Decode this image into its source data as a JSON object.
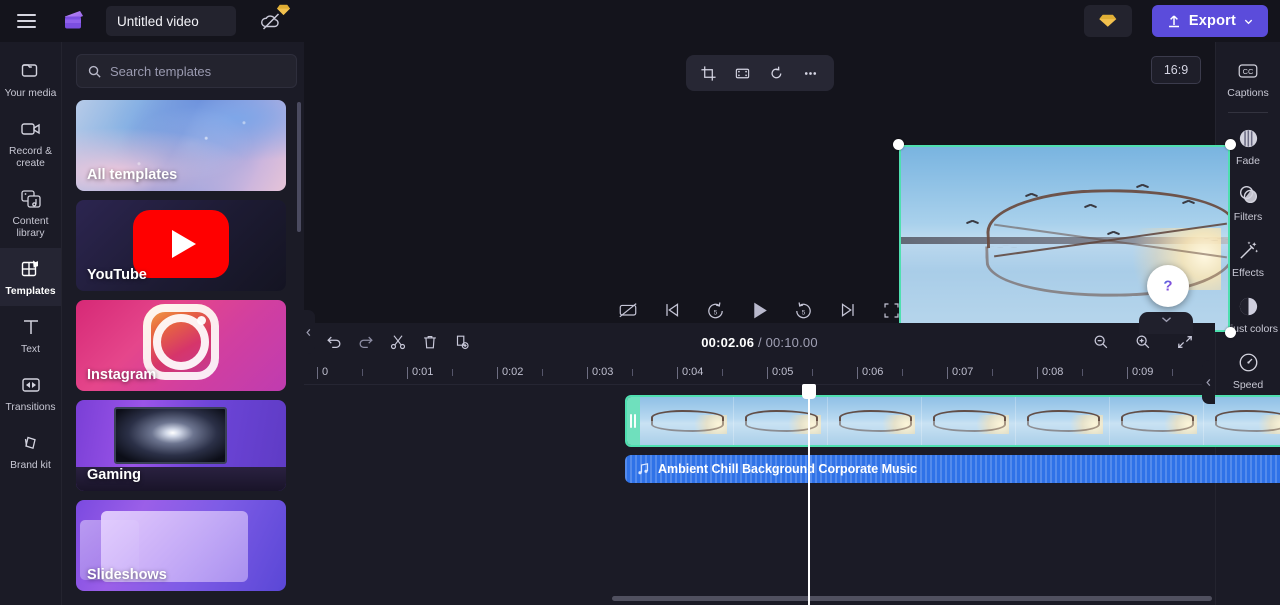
{
  "app": {
    "name": "Clipchamp",
    "accent": "#5b4cdb",
    "selection_color": "#4fe0b0",
    "audio_clip_color": "#2f72e8"
  },
  "topbar": {
    "menu_label": "menu",
    "project_title": "Untitled video",
    "project_title_placeholder": "Untitled video",
    "cloud_status_icon": "cloud-off-icon",
    "premium_badge_icon": "diamond-icon",
    "gem_button_icon": "diamond-icon",
    "export_label": "Export",
    "export_icon": "upload-icon",
    "export_chevron": "chevron-down-icon"
  },
  "left_rail": {
    "items": [
      {
        "label": "Your media",
        "icon": "folder-icon",
        "active": false
      },
      {
        "label": "Record & create",
        "icon": "video-camera-icon",
        "active": false
      },
      {
        "label": "Content library",
        "icon": "library-music-icon",
        "active": false
      },
      {
        "label": "Templates",
        "icon": "templates-grid-icon",
        "active": true
      },
      {
        "label": "Text",
        "icon": "text-t-icon",
        "active": false
      },
      {
        "label": "Transitions",
        "icon": "transitions-icon",
        "active": false
      },
      {
        "label": "Brand kit",
        "icon": "brand-kit-icon",
        "active": false
      }
    ]
  },
  "templates_panel": {
    "search_placeholder": "Search templates",
    "search_value": "",
    "search_icon": "search-icon",
    "filter_icon": "filter-icon",
    "collapse_icon": "chevron-left-icon",
    "cards": [
      {
        "label": "All templates",
        "style": "all-templates"
      },
      {
        "label": "YouTube",
        "style": "youtube"
      },
      {
        "label": "Instagram",
        "style": "instagram"
      },
      {
        "label": "Gaming",
        "style": "gaming"
      },
      {
        "label": "Slideshows",
        "style": "slideshows"
      }
    ]
  },
  "preview": {
    "toolbar": [
      {
        "name": "crop-icon",
        "label": "Crop"
      },
      {
        "name": "fit-icon",
        "label": "Fit"
      },
      {
        "name": "rotate-icon",
        "label": "Rotate"
      },
      {
        "name": "more-options-icon",
        "label": "More"
      }
    ],
    "aspect_ratio": "16:9",
    "playback": [
      {
        "name": "captions-off-icon",
        "label": "Captions off"
      },
      {
        "name": "skip-to-start-icon",
        "label": "Skip to start"
      },
      {
        "name": "rewind-5-icon",
        "label": "Back 5 seconds"
      },
      {
        "name": "play-icon",
        "label": "Play"
      },
      {
        "name": "forward-5-icon",
        "label": "Forward 5 seconds"
      },
      {
        "name": "skip-to-end-icon",
        "label": "Skip to end"
      },
      {
        "name": "fullscreen-icon",
        "label": "Fullscreen"
      }
    ],
    "help_label": "?",
    "collapse_down_icon": "chevron-down-icon"
  },
  "timeline": {
    "tools": [
      {
        "name": "undo-icon",
        "label": "Undo"
      },
      {
        "name": "redo-icon",
        "label": "Redo"
      },
      {
        "name": "split-icon",
        "label": "Split"
      },
      {
        "name": "delete-icon",
        "label": "Delete"
      },
      {
        "name": "duplicate-icon",
        "label": "Duplicate"
      }
    ],
    "current_time": "00:02.06",
    "separator": "/",
    "total_time": "00:10.00",
    "zoom_out_icon": "zoom-out-icon",
    "zoom_in_icon": "zoom-in-icon",
    "fit_timeline_icon": "fit-timeline-icon",
    "ruler_labels": [
      "0",
      "0:01",
      "0:02",
      "0:03",
      "0:04",
      "0:05",
      "0:06",
      "0:07",
      "0:08",
      "0:09"
    ],
    "video_clip": {
      "label": "",
      "selected": true
    },
    "audio_clip": {
      "label": "Ambient Chill Background Corporate Music",
      "icon": "music-note-icon"
    }
  },
  "right_rail": {
    "items": [
      {
        "label": "Captions",
        "icon": "cc-icon"
      },
      {
        "label": "Fade",
        "icon": "fade-icon"
      },
      {
        "label": "Filters",
        "icon": "filters-icon"
      },
      {
        "label": "Effects",
        "icon": "effects-wand-icon"
      },
      {
        "label": "Adjust colors",
        "icon": "adjust-colors-icon"
      },
      {
        "label": "Speed",
        "icon": "speed-gauge-icon"
      }
    ],
    "collapse_icon": "chevron-left-icon"
  }
}
